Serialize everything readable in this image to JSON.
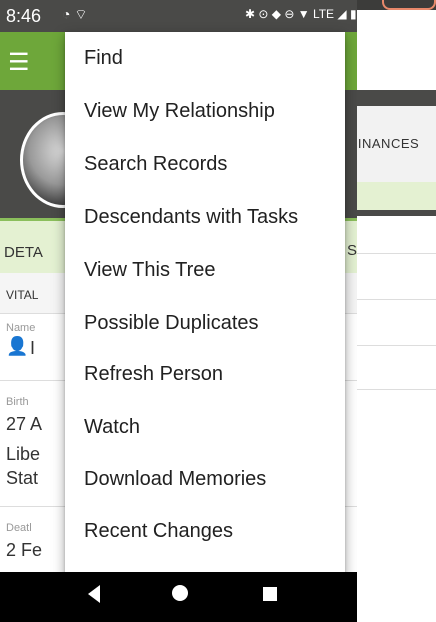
{
  "status_bar": {
    "time": "8:46",
    "left_icons": "◔ ⌔",
    "right_icons": "✱ ⊙ ◆ ⊖ ▼ LTE ◢ ▮"
  },
  "profile": {
    "right_tab_label": "DINANCES"
  },
  "details": {
    "tab_label": "DETA",
    "s_label": "S",
    "vital_label": "VITAL",
    "name_label": "Name",
    "name_value": "I",
    "birth_label": "Birth",
    "birth_date": "27 A",
    "birth_place_1": "Libe",
    "birth_place_2": "Stat",
    "death_label": "Deatl",
    "death_date": "2 Fe"
  },
  "menu": {
    "items": [
      "Find",
      "View My Relationship",
      "Search Records",
      "Descendants with Tasks",
      "View This Tree",
      "Possible Duplicates",
      "Refresh Person",
      "Watch",
      "Download Memories",
      "Recent Changes"
    ]
  },
  "colors": {
    "app_bar": "#6ea73a",
    "status_bar": "#4a4a48",
    "tab_bg": "#e4f1d2",
    "person_icon": "#2f76c6"
  },
  "icons": {
    "menu": "hamburger-icon",
    "person": "person-icon",
    "back": "back-triangle-icon",
    "home": "home-circle-icon",
    "recent": "recent-square-icon"
  }
}
